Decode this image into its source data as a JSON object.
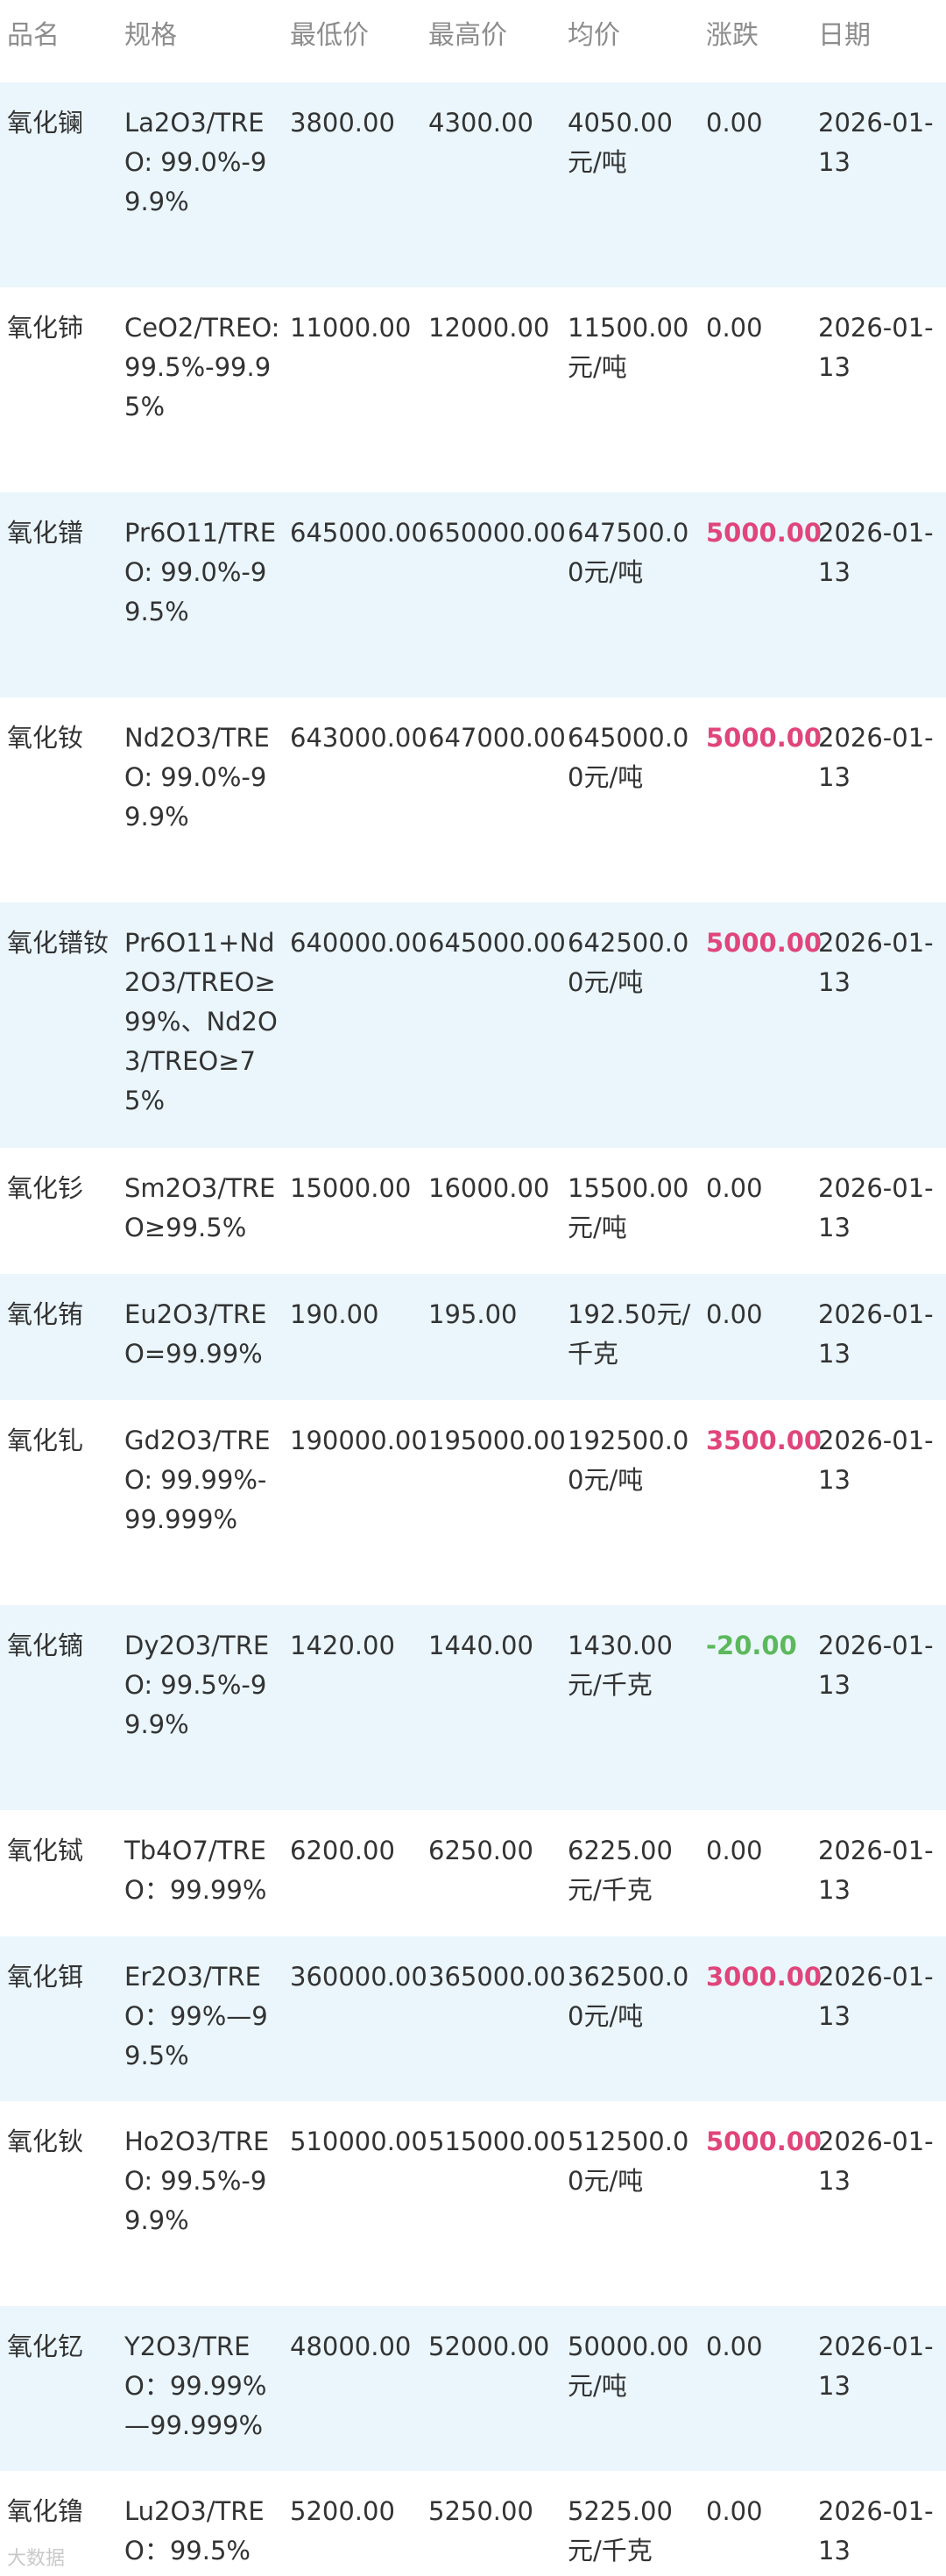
{
  "colors": {
    "row_alt_bg": "#eaf6fc",
    "header_text": "#8d8d8d",
    "body_text": "#333333",
    "change_up": "#e0457b",
    "change_down": "#5cb85c"
  },
  "table": {
    "headers": [
      "品名",
      "规格",
      "最低价",
      "最高价",
      "均价",
      "涨跌",
      "日期"
    ],
    "rows": [
      {
        "name": "氧化镧",
        "spec": "La2O3/TREO: 99.0%-99.9%",
        "low": "3800.00",
        "high": "4300.00",
        "avg": "4050.00元/吨",
        "change": "0.00",
        "trend": "flat",
        "date": "2026-01-13"
      },
      {
        "name": "氧化铈",
        "spec": "CeO2/TREO: 99.5%-99.95%",
        "low": "11000.00",
        "high": "12000.00",
        "avg": "11500.00元/吨",
        "change": "0.00",
        "trend": "flat",
        "date": "2026-01-13"
      },
      {
        "name": "氧化镨",
        "spec": "Pr6O11/TREO: 99.0%-99.5%",
        "low": "645000.00",
        "high": "650000.00",
        "avg": "647500.00元/吨",
        "change": "5000.00",
        "trend": "up",
        "date": "2026-01-13"
      },
      {
        "name": "氧化钕",
        "spec": "Nd2O3/TREO: 99.0%-99.9%",
        "low": "643000.00",
        "high": "647000.00",
        "avg": "645000.00元/吨",
        "change": "5000.00",
        "trend": "up",
        "date": "2026-01-13"
      },
      {
        "name": "氧化镨钕",
        "spec": "Pr6O11+Nd2O3/TREO≥99%、Nd2O3/TREO≥75%",
        "low": "640000.00",
        "high": "645000.00",
        "avg": "642500.00元/吨",
        "change": "5000.00",
        "trend": "up",
        "date": "2026-01-13"
      },
      {
        "name": "氧化钐",
        "spec": "Sm2O3/TREO≥99.5%",
        "low": "15000.00",
        "high": "16000.00",
        "avg": "15500.00元/吨",
        "change": "0.00",
        "trend": "flat",
        "date": "2026-01-13"
      },
      {
        "name": "氧化铕",
        "spec": "Eu2O3/TREO=99.99%",
        "low": "190.00",
        "high": "195.00",
        "avg": "192.50元/千克",
        "change": "0.00",
        "trend": "flat",
        "date": "2026-01-13"
      },
      {
        "name": "氧化钆",
        "spec": "Gd2O3/TREO: 99.99%-99.999%",
        "low": "190000.00",
        "high": "195000.00",
        "avg": "192500.00元/吨",
        "change": "3500.00",
        "trend": "up",
        "date": "2026-01-13"
      },
      {
        "name": "氧化镝",
        "spec": "Dy2O3/TREO: 99.5%-99.9%",
        "low": "1420.00",
        "high": "1440.00",
        "avg": "1430.00元/千克",
        "change": "-20.00",
        "trend": "down",
        "date": "2026-01-13"
      },
      {
        "name": "氧化铽",
        "spec": "Tb4O7/TREO：99.99%",
        "low": "6200.00",
        "high": "6250.00",
        "avg": "6225.00元/千克",
        "change": "0.00",
        "trend": "flat",
        "date": "2026-01-13"
      },
      {
        "name": "氧化铒",
        "spec": "Er2O3/TREO：99%—99.5%",
        "low": "360000.00",
        "high": "365000.00",
        "avg": "362500.00元/吨",
        "change": "3000.00",
        "trend": "up",
        "date": "2026-01-13"
      },
      {
        "name": "氧化钬",
        "spec": "Ho2O3/TREO: 99.5%-99.9%",
        "low": "510000.00",
        "high": "515000.00",
        "avg": "512500.00元/吨",
        "change": "5000.00",
        "trend": "up",
        "date": "2026-01-13"
      },
      {
        "name": "氧化钇",
        "spec": "Y2O3/TREO：99.99%—99.999%",
        "low": "48000.00",
        "high": "52000.00",
        "avg": "50000.00元/吨",
        "change": "0.00",
        "trend": "flat",
        "date": "2026-01-13"
      },
      {
        "name": "氧化镥",
        "spec": "Lu2O3/TREO：99.5%",
        "low": "5200.00",
        "high": "5250.00",
        "avg": "5225.00元/千克",
        "change": "0.00",
        "trend": "flat",
        "date": "2026-01-13"
      }
    ]
  },
  "watermark": "大数据"
}
